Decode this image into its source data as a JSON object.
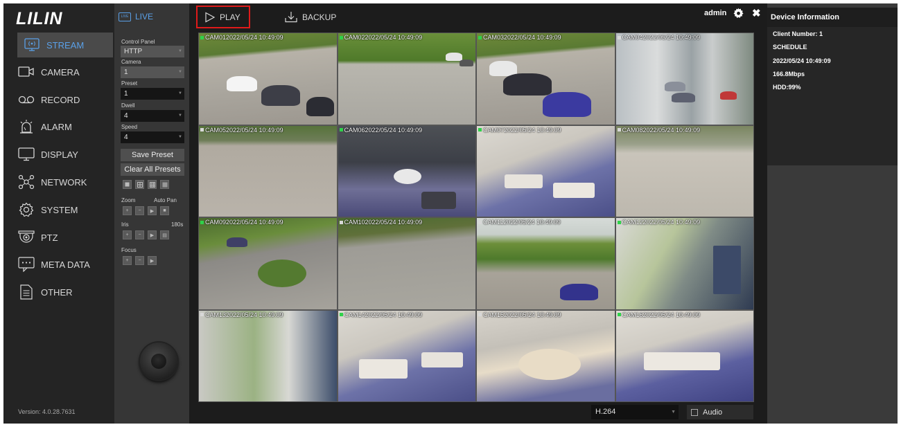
{
  "app": {
    "logo_text": "LILIN",
    "version": "Version: 4.0.28.7631"
  },
  "nav": {
    "items": [
      {
        "label": "STREAM",
        "icon": "stream-icon",
        "active": true
      },
      {
        "label": "CAMERA",
        "icon": "camera-icon"
      },
      {
        "label": "RECORD",
        "icon": "record-icon"
      },
      {
        "label": "ALARM",
        "icon": "alarm-icon"
      },
      {
        "label": "DISPLAY",
        "icon": "display-icon"
      },
      {
        "label": "NETWORK",
        "icon": "network-icon"
      },
      {
        "label": "SYSTEM",
        "icon": "system-icon"
      },
      {
        "label": "PTZ",
        "icon": "ptz-icon"
      },
      {
        "label": "META DATA",
        "icon": "meta-data-icon"
      },
      {
        "label": "OTHER",
        "icon": "other-icon"
      }
    ]
  },
  "panel": {
    "live_tab": "LIVE",
    "live_icon_text": "LIVE",
    "control_panel_label": "Control Panel",
    "control_panel_value": "HTTP",
    "camera_label": "Camera",
    "camera_value": "1",
    "preset_label": "Preset",
    "preset_value": "1",
    "dwell_label": "Dwell",
    "dwell_value": "4",
    "speed_label": "Speed",
    "speed_value": "4",
    "save_preset": "Save Preset",
    "clear_presets": "Clear All Presets",
    "zoom_label": "Zoom",
    "auto_pan_label": "Auto Pan",
    "iris_label": "Iris",
    "iris_value": "180s",
    "focus_label": "Focus"
  },
  "topbar": {
    "play": "PLAY",
    "backup": "BACKUP",
    "user": "admin"
  },
  "cameras": [
    {
      "label": "CAM012022/05/24 10:49:09",
      "status_color": "#2fd24a"
    },
    {
      "label": "CAM022022/05/24 10:49:09",
      "status_color": "#2fd24a"
    },
    {
      "label": "CAM032022/05/24 10:49:09",
      "status_color": "#2fd24a"
    },
    {
      "label": "CAM042022/05/24 10:49:09",
      "status_color": "#d8d8d8"
    },
    {
      "label": "CAM052022/05/24 10:49:09",
      "status_color": "#d8d8d8"
    },
    {
      "label": "CAM062022/05/24 10:49:09",
      "status_color": "#2fd24a"
    },
    {
      "label": "CAM072022/05/24 10:49:09",
      "status_color": "#2fd24a"
    },
    {
      "label": "CAM082022/05/24 10:49:09",
      "status_color": "#d8d8d8"
    },
    {
      "label": "CAM092022/05/24 10:49:09",
      "status_color": "#2fd24a"
    },
    {
      "label": "CAM102022/05/24 10:49:09",
      "status_color": "#d8d8d8"
    },
    {
      "label": "CAM112022/05/24 10:49:09",
      "status_color": "#d8d8d8"
    },
    {
      "label": "CAM122022/05/24 10:49:09",
      "status_color": "#2fd24a"
    },
    {
      "label": "CAM132022/05/24 10:49:09",
      "status_color": "#d8d8d8"
    },
    {
      "label": "CAM142022/05/24 10:49:09",
      "status_color": "#2fd24a"
    },
    {
      "label": "CAM152022/05/24 10:49:09",
      "status_color": "#d8d8d8"
    },
    {
      "label": "CAM162022/05/24 10:49:09",
      "status_color": "#2fd24a"
    }
  ],
  "bottombar": {
    "codec": "H.264",
    "audio": "Audio"
  },
  "info": {
    "title": "Device Information",
    "client_number": "Client Number: 1",
    "schedule": "SCHEDULE",
    "datetime": "2022/05/24 10:49:09",
    "bitrate": "166.8Mbps",
    "hdd": "HDD:99%"
  },
  "colors": {
    "accent": "#5aa0e8",
    "play_highlight": "#e01a1a",
    "status_active": "#2fd24a"
  }
}
